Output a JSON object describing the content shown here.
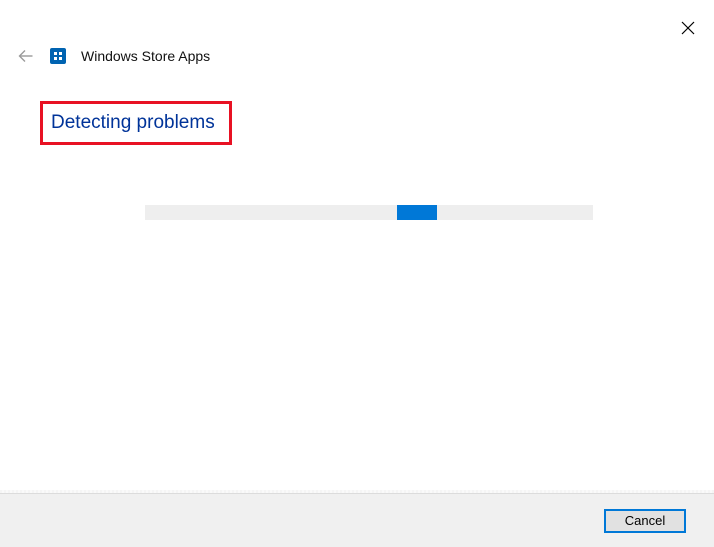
{
  "window": {
    "title": "Windows Store Apps"
  },
  "main": {
    "status": "Detecting problems"
  },
  "footer": {
    "cancel_label": "Cancel"
  },
  "colors": {
    "accent": "#0078d7",
    "link": "#003399",
    "highlight_border": "#e81123"
  }
}
